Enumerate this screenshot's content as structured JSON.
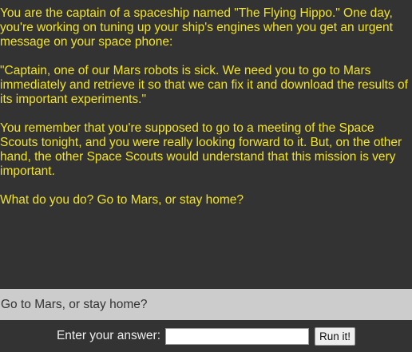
{
  "story": {
    "paragraphs": [
      "You are the captain of a spaceship named \"The Flying Hippo.\" One day, you're working on tuning up your ship's engines when you get an urgent message on your space phone:",
      "\"Captain, one of our Mars robots is sick. We need you to go to Mars immediately and retrieve it so that we can fix it and download the results of its important experiments.\"",
      "You remember that you're supposed to go to a meeting of the Space Scouts tonight, and you were really looking forward to it. But, on the other hand, the other Space Scouts would understand that this mission is very important.",
      "What do you do? Go to Mars, or stay home?"
    ]
  },
  "prompt": {
    "text": "Go to Mars, or stay home?"
  },
  "answer": {
    "label": "Enter your answer:",
    "value": "",
    "placeholder": ""
  },
  "run_button": {
    "label": "Run it!"
  },
  "colors": {
    "background": "#333333",
    "story_text": "#f2e32c",
    "prompt_bar": "#cccccc"
  }
}
